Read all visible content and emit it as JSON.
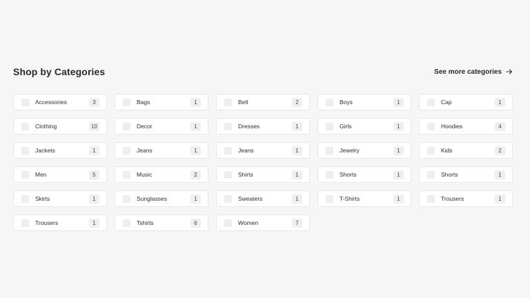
{
  "section": {
    "title": "Shop by Categories",
    "see_more_label": "See more categories",
    "see_more_icon": "arrow-right-icon"
  },
  "categories": [
    {
      "label": "Accessories",
      "count": "3"
    },
    {
      "label": "Bags",
      "count": "1"
    },
    {
      "label": "Belt",
      "count": "2"
    },
    {
      "label": "Boys",
      "count": "1"
    },
    {
      "label": "Cap",
      "count": "1"
    },
    {
      "label": "Clothing",
      "count": "10"
    },
    {
      "label": "Decor",
      "count": "1"
    },
    {
      "label": "Dresses",
      "count": "1"
    },
    {
      "label": "Girls",
      "count": "1"
    },
    {
      "label": "Hoodies",
      "count": "4"
    },
    {
      "label": "Jackets",
      "count": "1"
    },
    {
      "label": "Jeans",
      "count": "1"
    },
    {
      "label": "Jeans",
      "count": "1"
    },
    {
      "label": "Jewelry",
      "count": "1"
    },
    {
      "label": "Kids",
      "count": "2"
    },
    {
      "label": "Men",
      "count": "5"
    },
    {
      "label": "Music",
      "count": "2"
    },
    {
      "label": "Shirts",
      "count": "1"
    },
    {
      "label": "Shorts",
      "count": "1"
    },
    {
      "label": "Shorts",
      "count": "1"
    },
    {
      "label": "Skirts",
      "count": "1"
    },
    {
      "label": "Sunglasses",
      "count": "1"
    },
    {
      "label": "Sweaters",
      "count": "1"
    },
    {
      "label": "T-Shirts",
      "count": "1"
    },
    {
      "label": "Trousers",
      "count": "1"
    },
    {
      "label": "Trousers",
      "count": "1"
    },
    {
      "label": "Tshirts",
      "count": "6"
    },
    {
      "label": "Women",
      "count": "7"
    }
  ],
  "colors": {
    "background": "#f6f6f6",
    "card": "#ffffff",
    "border": "#e6e6e6",
    "badge": "#efefef",
    "text": "#2a2a2a"
  }
}
